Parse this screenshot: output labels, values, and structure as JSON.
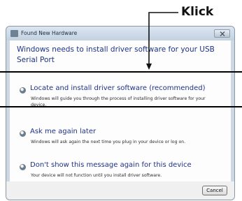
{
  "dialog": {
    "title": "Found New Hardware",
    "heading": "Windows needs to install driver software for your USB Serial Port",
    "options": [
      {
        "title": "Locate and install driver software (recommended)",
        "description": "Windows will guide you through the process of installing driver software for your device."
      },
      {
        "title": "Ask me again later",
        "description": "Windows will ask again the next time you plug in your device or log on."
      },
      {
        "title": "Don't show this message again for this device",
        "description": "Your device will not function until you install driver software."
      }
    ],
    "cancel_label": "Cancel"
  },
  "annotation": {
    "label": "Klick"
  }
}
